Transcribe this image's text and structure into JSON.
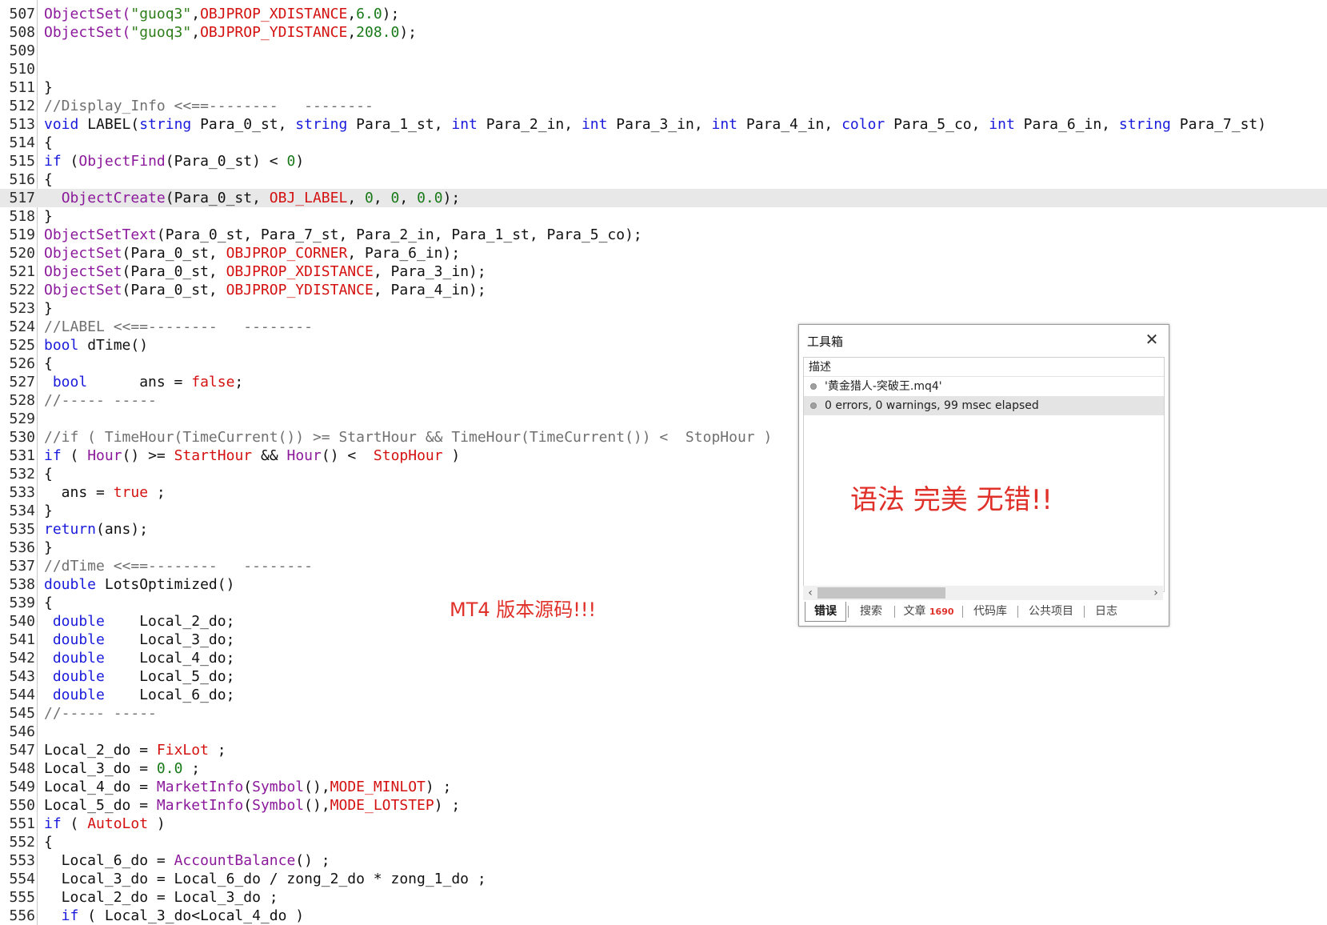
{
  "editor": {
    "lines": [
      {
        "n": "507",
        "highlight": false,
        "tokens": [
          {
            "t": "ObjectSet(",
            "c": "fn"
          },
          {
            "t": "\"guoq3\"",
            "c": "str"
          },
          {
            "t": ",",
            "c": "plain"
          },
          {
            "t": "OBJPROP_XDISTANCE",
            "c": "const"
          },
          {
            "t": ",",
            "c": "plain"
          },
          {
            "t": "6.0",
            "c": "num"
          },
          {
            "t": ");",
            "c": "plain"
          }
        ]
      },
      {
        "n": "508",
        "highlight": false,
        "tokens": [
          {
            "t": "ObjectSet(",
            "c": "fn"
          },
          {
            "t": "\"guoq3\"",
            "c": "str"
          },
          {
            "t": ",",
            "c": "plain"
          },
          {
            "t": "OBJPROP_YDISTANCE",
            "c": "const"
          },
          {
            "t": ",",
            "c": "plain"
          },
          {
            "t": "208.0",
            "c": "num"
          },
          {
            "t": ");",
            "c": "plain"
          }
        ]
      },
      {
        "n": "509",
        "highlight": false,
        "tokens": []
      },
      {
        "n": "510",
        "highlight": false,
        "tokens": []
      },
      {
        "n": "511",
        "highlight": false,
        "tokens": [
          {
            "t": "}",
            "c": "plain"
          }
        ]
      },
      {
        "n": "512",
        "highlight": false,
        "tokens": [
          {
            "t": "//Display_Info <<==--------   --------",
            "c": "cm"
          }
        ]
      },
      {
        "n": "513",
        "highlight": false,
        "tokens": [
          {
            "t": "void",
            "c": "kw"
          },
          {
            "t": " LABEL(",
            "c": "plain"
          },
          {
            "t": "string",
            "c": "kw"
          },
          {
            "t": " Para_0_st, ",
            "c": "plain"
          },
          {
            "t": "string",
            "c": "kw"
          },
          {
            "t": " Para_1_st, ",
            "c": "plain"
          },
          {
            "t": "int",
            "c": "kw"
          },
          {
            "t": " Para_2_in, ",
            "c": "plain"
          },
          {
            "t": "int",
            "c": "kw"
          },
          {
            "t": " Para_3_in, ",
            "c": "plain"
          },
          {
            "t": "int",
            "c": "kw"
          },
          {
            "t": " Para_4_in, ",
            "c": "plain"
          },
          {
            "t": "color",
            "c": "kw"
          },
          {
            "t": " Para_5_co, ",
            "c": "plain"
          },
          {
            "t": "int",
            "c": "kw"
          },
          {
            "t": " Para_6_in, ",
            "c": "plain"
          },
          {
            "t": "string",
            "c": "kw"
          },
          {
            "t": " Para_7_st)",
            "c": "plain"
          }
        ]
      },
      {
        "n": "514",
        "highlight": false,
        "tokens": [
          {
            "t": "{",
            "c": "plain"
          }
        ]
      },
      {
        "n": "515",
        "highlight": false,
        "tokens": [
          {
            "t": "if",
            "c": "kw"
          },
          {
            "t": " (",
            "c": "plain"
          },
          {
            "t": "ObjectFind",
            "c": "fn"
          },
          {
            "t": "(Para_0_st) < ",
            "c": "plain"
          },
          {
            "t": "0",
            "c": "num"
          },
          {
            "t": ")",
            "c": "plain"
          }
        ]
      },
      {
        "n": "516",
        "highlight": false,
        "tokens": [
          {
            "t": "{",
            "c": "plain"
          }
        ]
      },
      {
        "n": "517",
        "highlight": true,
        "tokens": [
          {
            "t": "  ",
            "c": "plain"
          },
          {
            "t": "ObjectCreate",
            "c": "fn"
          },
          {
            "t": "(Para_0_st, ",
            "c": "plain"
          },
          {
            "t": "OBJ_LABEL",
            "c": "const"
          },
          {
            "t": ", ",
            "c": "plain"
          },
          {
            "t": "0",
            "c": "num"
          },
          {
            "t": ", ",
            "c": "plain"
          },
          {
            "t": "0",
            "c": "num"
          },
          {
            "t": ", ",
            "c": "plain"
          },
          {
            "t": "0.0",
            "c": "num"
          },
          {
            "t": ");",
            "c": "plain"
          }
        ]
      },
      {
        "n": "518",
        "highlight": false,
        "tokens": [
          {
            "t": "}",
            "c": "plain"
          }
        ]
      },
      {
        "n": "519",
        "highlight": false,
        "tokens": [
          {
            "t": "ObjectSetText",
            "c": "fn"
          },
          {
            "t": "(Para_0_st, Para_7_st, Para_2_in, Para_1_st, Para_5_co);",
            "c": "plain"
          }
        ]
      },
      {
        "n": "520",
        "highlight": false,
        "tokens": [
          {
            "t": "ObjectSet",
            "c": "fn"
          },
          {
            "t": "(Para_0_st, ",
            "c": "plain"
          },
          {
            "t": "OBJPROP_CORNER",
            "c": "const"
          },
          {
            "t": ", Para_6_in);",
            "c": "plain"
          }
        ]
      },
      {
        "n": "521",
        "highlight": false,
        "tokens": [
          {
            "t": "ObjectSet",
            "c": "fn"
          },
          {
            "t": "(Para_0_st, ",
            "c": "plain"
          },
          {
            "t": "OBJPROP_XDISTANCE",
            "c": "const"
          },
          {
            "t": ", Para_3_in);",
            "c": "plain"
          }
        ]
      },
      {
        "n": "522",
        "highlight": false,
        "tokens": [
          {
            "t": "ObjectSet",
            "c": "fn"
          },
          {
            "t": "(Para_0_st, ",
            "c": "plain"
          },
          {
            "t": "OBJPROP_YDISTANCE",
            "c": "const"
          },
          {
            "t": ", Para_4_in);",
            "c": "plain"
          }
        ]
      },
      {
        "n": "523",
        "highlight": false,
        "tokens": [
          {
            "t": "}",
            "c": "plain"
          }
        ]
      },
      {
        "n": "524",
        "highlight": false,
        "tokens": [
          {
            "t": "//LABEL <<==--------   --------",
            "c": "cm"
          }
        ]
      },
      {
        "n": "525",
        "highlight": false,
        "tokens": [
          {
            "t": "bool",
            "c": "kw"
          },
          {
            "t": " dTime()",
            "c": "plain"
          }
        ]
      },
      {
        "n": "526",
        "highlight": false,
        "tokens": [
          {
            "t": "{",
            "c": "plain"
          }
        ]
      },
      {
        "n": "527",
        "highlight": false,
        "tokens": [
          {
            "t": " bool",
            "c": "kw"
          },
          {
            "t": "      ans = ",
            "c": "plain"
          },
          {
            "t": "false",
            "c": "const"
          },
          {
            "t": ";",
            "c": "plain"
          }
        ]
      },
      {
        "n": "528",
        "highlight": false,
        "tokens": [
          {
            "t": "//----- -----",
            "c": "cm"
          }
        ]
      },
      {
        "n": "529",
        "highlight": false,
        "tokens": []
      },
      {
        "n": "530",
        "highlight": false,
        "tokens": [
          {
            "t": "//if ( TimeHour(TimeCurrent()) >= StartHour && TimeHour(TimeCurrent()) <  StopHour )",
            "c": "cm"
          }
        ]
      },
      {
        "n": "531",
        "highlight": false,
        "tokens": [
          {
            "t": "if",
            "c": "kw"
          },
          {
            "t": " ( ",
            "c": "plain"
          },
          {
            "t": "Hour",
            "c": "fn"
          },
          {
            "t": "() >= ",
            "c": "plain"
          },
          {
            "t": "StartHour",
            "c": "const"
          },
          {
            "t": " && ",
            "c": "plain"
          },
          {
            "t": "Hour",
            "c": "fn"
          },
          {
            "t": "() <  ",
            "c": "plain"
          },
          {
            "t": "StopHour",
            "c": "const"
          },
          {
            "t": " )",
            "c": "plain"
          }
        ]
      },
      {
        "n": "532",
        "highlight": false,
        "tokens": [
          {
            "t": "{",
            "c": "plain"
          }
        ]
      },
      {
        "n": "533",
        "highlight": false,
        "tokens": [
          {
            "t": "  ans = ",
            "c": "plain"
          },
          {
            "t": "true",
            "c": "const"
          },
          {
            "t": " ;",
            "c": "plain"
          }
        ]
      },
      {
        "n": "534",
        "highlight": false,
        "tokens": [
          {
            "t": "}",
            "c": "plain"
          }
        ]
      },
      {
        "n": "535",
        "highlight": false,
        "tokens": [
          {
            "t": "return",
            "c": "kw"
          },
          {
            "t": "(ans);",
            "c": "plain"
          }
        ]
      },
      {
        "n": "536",
        "highlight": false,
        "tokens": [
          {
            "t": "}",
            "c": "plain"
          }
        ]
      },
      {
        "n": "537",
        "highlight": false,
        "tokens": [
          {
            "t": "//dTime <<==--------   --------",
            "c": "cm"
          }
        ]
      },
      {
        "n": "538",
        "highlight": false,
        "tokens": [
          {
            "t": "double",
            "c": "kw"
          },
          {
            "t": " LotsOptimized()",
            "c": "plain"
          }
        ]
      },
      {
        "n": "539",
        "highlight": false,
        "tokens": [
          {
            "t": "{",
            "c": "plain"
          }
        ]
      },
      {
        "n": "540",
        "highlight": false,
        "tokens": [
          {
            "t": " double",
            "c": "kw"
          },
          {
            "t": "    Local_2_do;",
            "c": "plain"
          }
        ]
      },
      {
        "n": "541",
        "highlight": false,
        "tokens": [
          {
            "t": " double",
            "c": "kw"
          },
          {
            "t": "    Local_3_do;",
            "c": "plain"
          }
        ]
      },
      {
        "n": "542",
        "highlight": false,
        "tokens": [
          {
            "t": " double",
            "c": "kw"
          },
          {
            "t": "    Local_4_do;",
            "c": "plain"
          }
        ]
      },
      {
        "n": "543",
        "highlight": false,
        "tokens": [
          {
            "t": " double",
            "c": "kw"
          },
          {
            "t": "    Local_5_do;",
            "c": "plain"
          }
        ]
      },
      {
        "n": "544",
        "highlight": false,
        "tokens": [
          {
            "t": " double",
            "c": "kw"
          },
          {
            "t": "    Local_6_do;",
            "c": "plain"
          }
        ]
      },
      {
        "n": "545",
        "highlight": false,
        "tokens": [
          {
            "t": "//----- -----",
            "c": "cm"
          }
        ]
      },
      {
        "n": "546",
        "highlight": false,
        "tokens": []
      },
      {
        "n": "547",
        "highlight": false,
        "tokens": [
          {
            "t": "Local_2_do = ",
            "c": "plain"
          },
          {
            "t": "FixLot",
            "c": "const"
          },
          {
            "t": " ;",
            "c": "plain"
          }
        ]
      },
      {
        "n": "548",
        "highlight": false,
        "tokens": [
          {
            "t": "Local_3_do = ",
            "c": "plain"
          },
          {
            "t": "0.0",
            "c": "num"
          },
          {
            "t": " ;",
            "c": "plain"
          }
        ]
      },
      {
        "n": "549",
        "highlight": false,
        "tokens": [
          {
            "t": "Local_4_do = ",
            "c": "plain"
          },
          {
            "t": "MarketInfo",
            "c": "fn"
          },
          {
            "t": "(",
            "c": "plain"
          },
          {
            "t": "Symbol",
            "c": "fn"
          },
          {
            "t": "(),",
            "c": "plain"
          },
          {
            "t": "MODE_MINLOT",
            "c": "const"
          },
          {
            "t": ") ;",
            "c": "plain"
          }
        ]
      },
      {
        "n": "550",
        "highlight": false,
        "tokens": [
          {
            "t": "Local_5_do = ",
            "c": "plain"
          },
          {
            "t": "MarketInfo",
            "c": "fn"
          },
          {
            "t": "(",
            "c": "plain"
          },
          {
            "t": "Symbol",
            "c": "fn"
          },
          {
            "t": "(),",
            "c": "plain"
          },
          {
            "t": "MODE_LOTSTEP",
            "c": "const"
          },
          {
            "t": ") ;",
            "c": "plain"
          }
        ]
      },
      {
        "n": "551",
        "highlight": false,
        "tokens": [
          {
            "t": "if",
            "c": "kw"
          },
          {
            "t": " ( ",
            "c": "plain"
          },
          {
            "t": "AutoLot",
            "c": "const"
          },
          {
            "t": " )",
            "c": "plain"
          }
        ]
      },
      {
        "n": "552",
        "highlight": false,
        "tokens": [
          {
            "t": "{",
            "c": "plain"
          }
        ]
      },
      {
        "n": "553",
        "highlight": false,
        "tokens": [
          {
            "t": "  Local_6_do = ",
            "c": "plain"
          },
          {
            "t": "AccountBalance",
            "c": "fn"
          },
          {
            "t": "() ;",
            "c": "plain"
          }
        ]
      },
      {
        "n": "554",
        "highlight": false,
        "tokens": [
          {
            "t": "  Local_3_do = Local_6_do / zong_2_do * zong_1_do ;",
            "c": "plain"
          }
        ]
      },
      {
        "n": "555",
        "highlight": false,
        "tokens": [
          {
            "t": "  Local_2_do = Local_3_do ;",
            "c": "plain"
          }
        ]
      },
      {
        "n": "556",
        "highlight": false,
        "tokens": [
          {
            "t": "  if",
            "c": "kw"
          },
          {
            "t": " ( Local_3_do<Local_4_do )",
            "c": "plain"
          }
        ]
      }
    ],
    "colors": {
      "keyword": "#1a1adb",
      "function": "#8b1a9b",
      "string": "#2e7d1a",
      "constant": "#d41111",
      "number": "#1a7a1a",
      "comment": "#707070",
      "highlight": "#e8e8e8"
    }
  },
  "annotation": {
    "text": "MT4 版本源码!!!",
    "color": "#e0302a"
  },
  "toolbox": {
    "title": "工具箱",
    "close_icon": "close-icon",
    "column_header": "描述",
    "rows": [
      {
        "text": "'黄金猎人-突破王.mq4'",
        "selected": false
      },
      {
        "text": "0 errors, 0 warnings, 99 msec elapsed",
        "selected": true
      }
    ],
    "overlay_text": "语法 完美 无错!!",
    "tabs": [
      {
        "label": "错误",
        "badge": "",
        "active": true
      },
      {
        "label": "搜索",
        "badge": "",
        "active": false
      },
      {
        "label": "文章",
        "badge": "1690",
        "active": false
      },
      {
        "label": "代码库",
        "badge": "",
        "active": false
      },
      {
        "label": "公共项目",
        "badge": "",
        "active": false
      },
      {
        "label": "日志",
        "badge": "",
        "active": false
      }
    ]
  }
}
